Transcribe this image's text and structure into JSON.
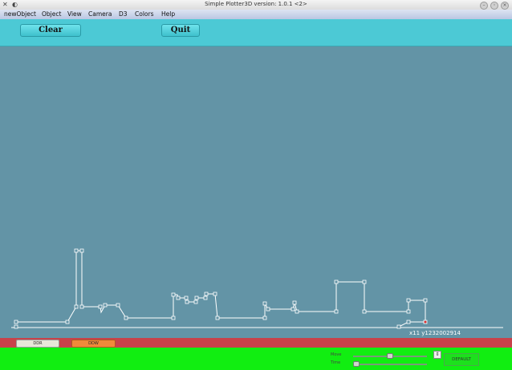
{
  "window": {
    "title": "Simple Plotter3D   version: 1.0.1 <2>"
  },
  "menu": [
    "newObject",
    "Object",
    "View",
    "Camera",
    "D3",
    "Colors",
    "Help"
  ],
  "toolbar": {
    "clear_label": "Clear",
    "quit_label": "Quit"
  },
  "canvas": {
    "coordinate_readout": "x11 y1232002914"
  },
  "status": {
    "button1_label": "DDR",
    "button2_label": "DDW"
  },
  "controls": {
    "slider1_label": "Move",
    "slider2_label": "Time",
    "slider1_value": 0.5,
    "slider2_value": 0.0,
    "default_label": "DEFAULT"
  },
  "colors": {
    "toolbar": "#4cc9d5",
    "canvas": "#6394a6",
    "status": "#c8424a",
    "bottom": "#11ee11"
  }
}
